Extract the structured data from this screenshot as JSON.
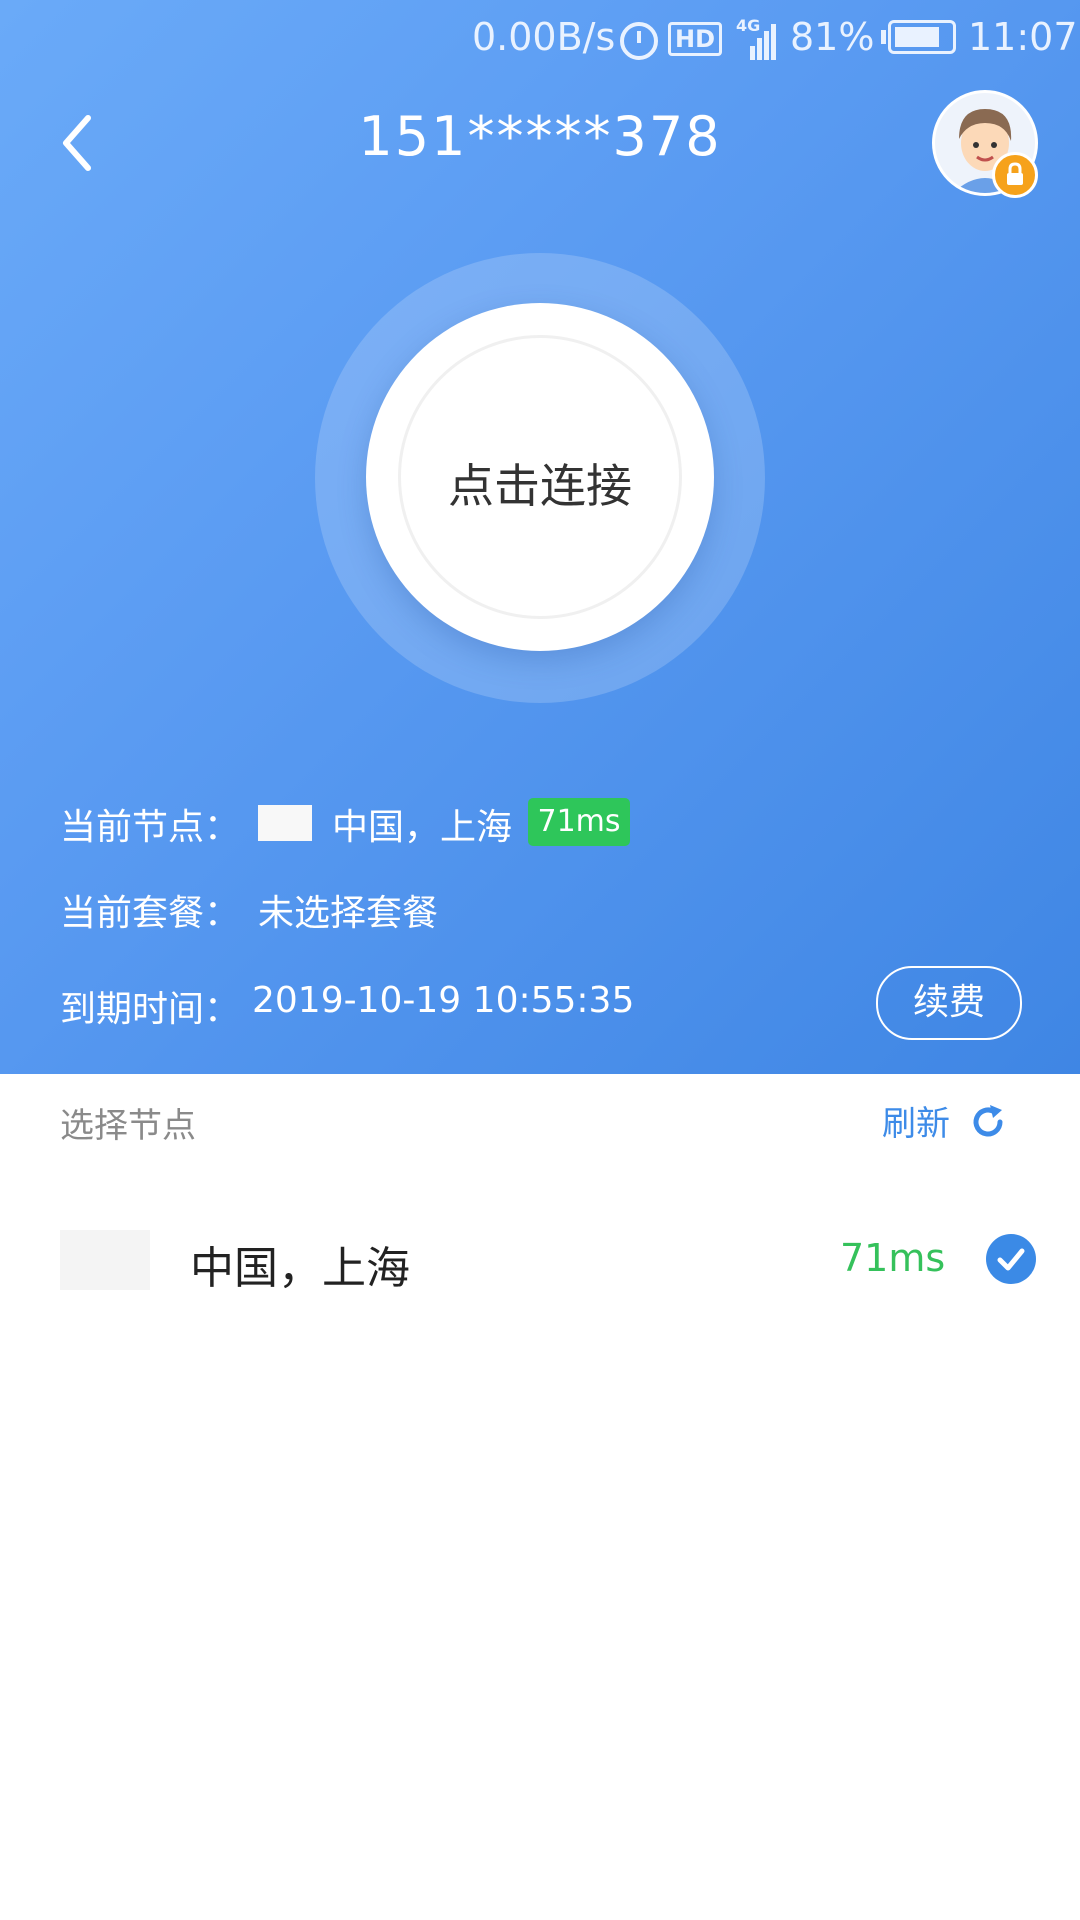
{
  "status_bar": {
    "speed": "0.00B/s",
    "hd": "HD",
    "network": "4G",
    "battery": "81%",
    "battery_level": 0.81,
    "time": "11:07"
  },
  "header": {
    "title": "151*****378"
  },
  "connect": {
    "label": "点击连接"
  },
  "info": {
    "node_label": "当前节点：",
    "node_value": "中国，上海",
    "node_ping": "71ms",
    "plan_label": "当前套餐：",
    "plan_value": "未选择套餐",
    "expire_label": "到期时间：",
    "expire_value": "2019-10-19 10:55:35",
    "renew_button": "续费"
  },
  "list": {
    "title": "选择节点",
    "refresh": "刷新",
    "nodes": [
      {
        "name": "中国，上海",
        "ping": "71ms",
        "selected": true
      }
    ]
  },
  "colors": {
    "accent": "#3b8ae6",
    "ping_green": "#2ec65a",
    "lock_badge": "#f6a21b"
  }
}
